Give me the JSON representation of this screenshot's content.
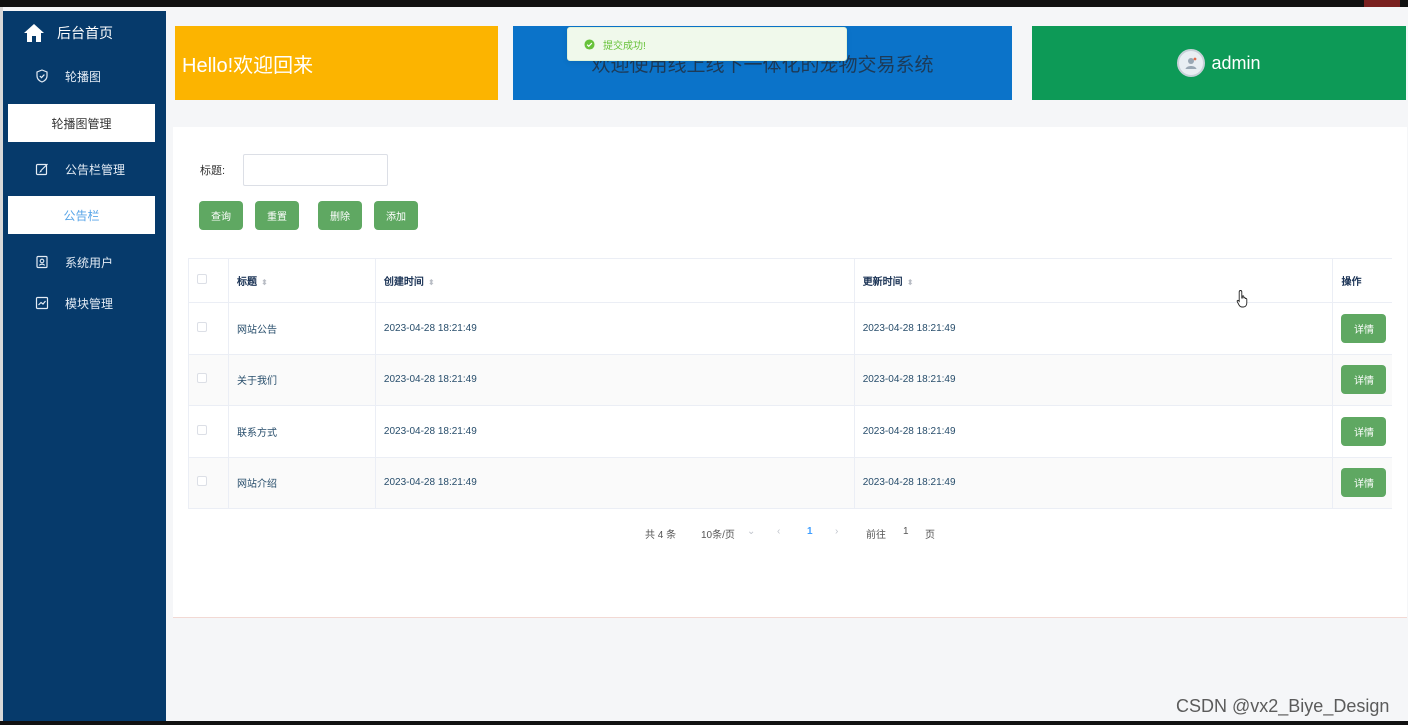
{
  "sidebar": {
    "home": "后台首页",
    "items": [
      {
        "label": "轮播图",
        "icon": "shield-icon"
      },
      {
        "label": "轮播图管理",
        "sub": true
      },
      {
        "label": "公告栏管理",
        "icon": "edit-icon"
      },
      {
        "label": "公告栏",
        "sub": true,
        "active": true
      },
      {
        "label": "系统用户",
        "icon": "user-card-icon"
      },
      {
        "label": "模块管理",
        "icon": "chart-icon"
      }
    ]
  },
  "header": {
    "hello": "Hello!欢迎回来",
    "welcome": "欢迎使用线上线下一体化的宠物交易系统",
    "user": "admin"
  },
  "toast": {
    "message": "提交成功!"
  },
  "search": {
    "label": "标题:",
    "value": "",
    "placeholder": ""
  },
  "buttons": {
    "query": "查询",
    "reset": "重置",
    "delete": "删除",
    "add": "添加"
  },
  "table": {
    "headers": {
      "title": "标题",
      "created": "创建时间",
      "updated": "更新时间",
      "action": "操作"
    },
    "rows": [
      {
        "title": "网站公告",
        "created": "2023-04-28 18:21:49",
        "updated": "2023-04-28 18:21:49",
        "action": "详情"
      },
      {
        "title": "关于我们",
        "created": "2023-04-28 18:21:49",
        "updated": "2023-04-28 18:21:49",
        "action": "详情"
      },
      {
        "title": "联系方式",
        "created": "2023-04-28 18:21:49",
        "updated": "2023-04-28 18:21:49",
        "action": "详情"
      },
      {
        "title": "网站介绍",
        "created": "2023-04-28 18:21:49",
        "updated": "2023-04-28 18:21:49",
        "action": "详情"
      }
    ]
  },
  "pagination": {
    "total": "共 4 条",
    "page_size": "10条/页",
    "current_page": "1",
    "goto_prefix": "前往",
    "goto_value": "1",
    "goto_suffix": "页"
  },
  "watermark": "CSDN @vx2_Biye_Design",
  "colors": {
    "sidebar": "#063a6b",
    "hello_card": "#fcb400",
    "welcome_card": "#0b73c9",
    "admin_card": "#0d9a57",
    "button": "#5fa862",
    "toast_text": "#67c23a"
  }
}
